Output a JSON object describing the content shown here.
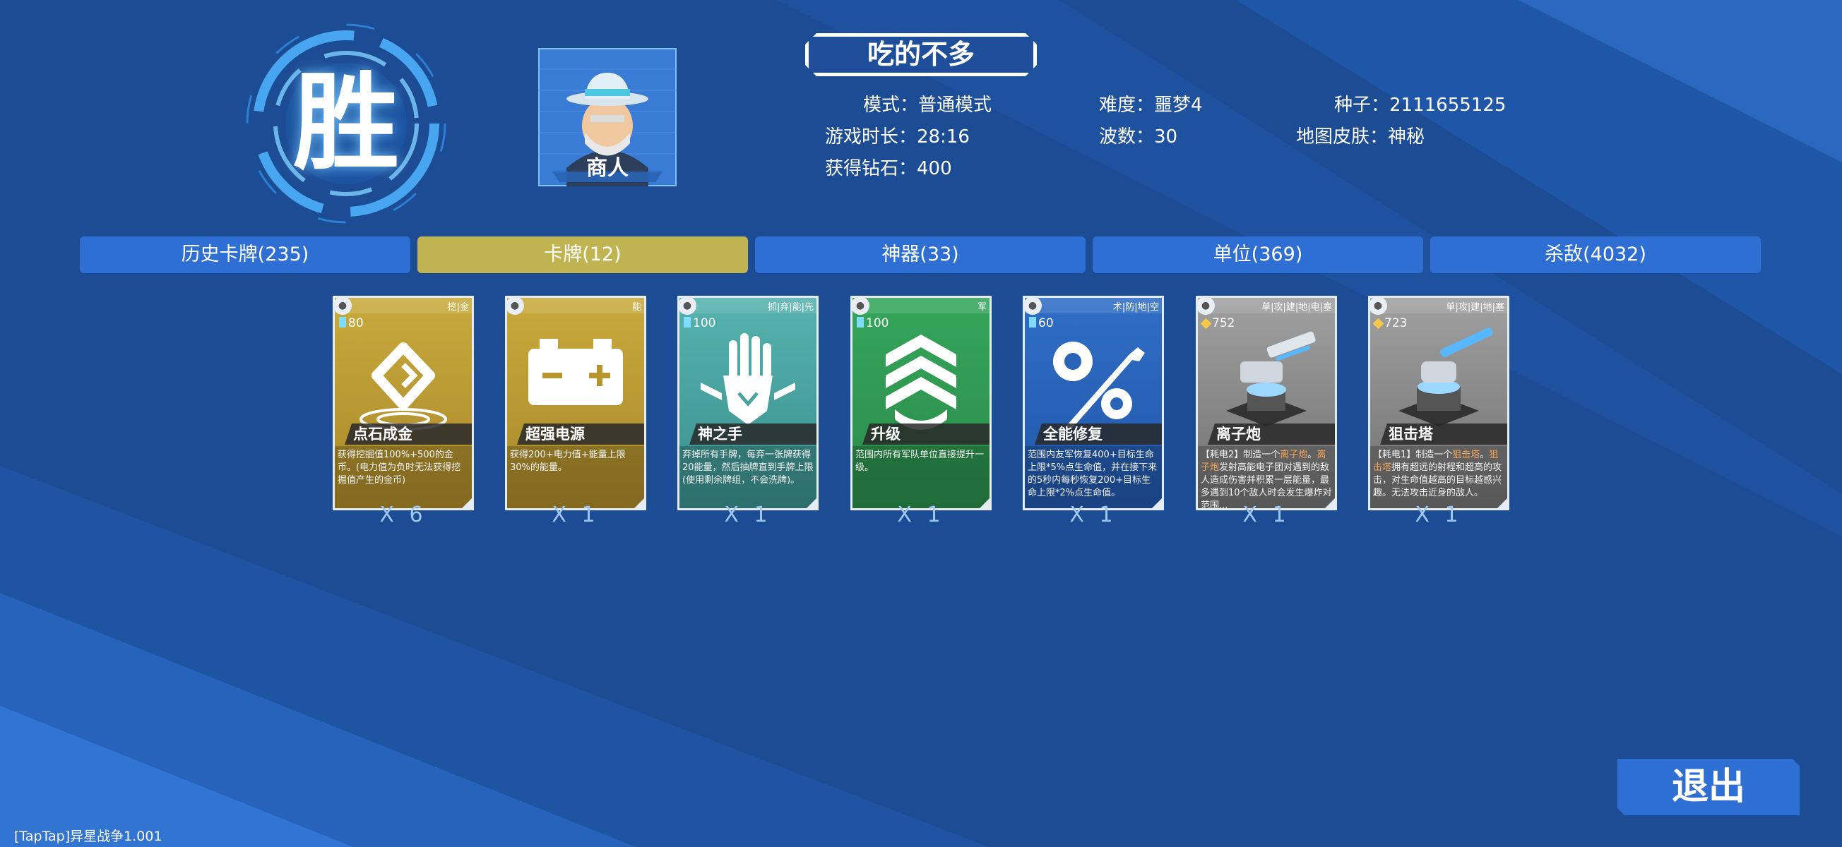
{
  "result_char": "胜",
  "character": {
    "name": "商人"
  },
  "title": "吃的不多",
  "stats": {
    "mode": {
      "label": "模式：",
      "value": "普通模式"
    },
    "difficulty": {
      "label": "难度：",
      "value": "噩梦4"
    },
    "seed": {
      "label": "种子：",
      "value": "2111655125"
    },
    "time": {
      "label": "游戏时长：",
      "value": "28:16"
    },
    "waves": {
      "label": "波数：",
      "value": "30"
    },
    "skin": {
      "label": "地图皮肤：",
      "value": "神秘"
    },
    "diamonds": {
      "label": "获得钻石：",
      "value": "400"
    }
  },
  "tabs": [
    "历史卡牌(235)",
    "卡牌(12)",
    "神器(33)",
    "单位(369)",
    "杀敌(4032)"
  ],
  "active_tab": 1,
  "cards": [
    {
      "name": "点石成金",
      "tags": "挖|金",
      "cost": "80",
      "cost_type": "energy",
      "count": "X 6",
      "desc": "获得挖掘值100%+500的金币。(电力值为负时无法获得挖掘值产生的金币)"
    },
    {
      "name": "超强电源",
      "tags": "能",
      "cost": "",
      "cost_type": "energy",
      "count": "X 1",
      "desc": "获得200+电力值+能量上限30%的能量。"
    },
    {
      "name": "神之手",
      "tags": "抓|弃|能|先",
      "cost": "100",
      "cost_type": "energy",
      "count": "X 1",
      "desc": "弃掉所有手牌，每弃一张牌获得20能量，然后抽牌直到手牌上限(使用剩余牌组，不会洗牌)。"
    },
    {
      "name": "升级",
      "tags": "军",
      "cost": "100",
      "cost_type": "energy",
      "count": "X 1",
      "desc": "范围内所有军队单位直接提升一级。"
    },
    {
      "name": "全能修复",
      "tags": "术|防|地|空",
      "cost": "60",
      "cost_type": "energy",
      "count": "X 1",
      "desc": "范围内友军恢复400+目标生命上限*5%点生命值，并在接下来的5秒内每秒恢复200+目标生命上限*2%点生命值。"
    },
    {
      "name": "离子炮",
      "tags": "单|攻|建|地|电|塞",
      "cost": "752",
      "cost_type": "gold",
      "count": "X 1",
      "desc_pre": "【耗电2】制造一个",
      "desc_hl": "离子炮",
      "desc_hl2": "离子炮",
      "desc_post": "发射高能电子团对遇到的敌人造成伤害并积累一层能量，最多遇到10个敌人时会发生爆炸对范围..."
    },
    {
      "name": "狙击塔",
      "tags": "单|攻|建|地|塞",
      "cost": "723",
      "cost_type": "gold",
      "count": "X 1",
      "desc_pre": "【耗电1】制造一个",
      "desc_hl": "狙击塔",
      "desc_hl2": "狙击塔",
      "desc_post": "拥有超远的射程和超高的攻击，对生命值越高的目标越感兴趣。无法攻击近身的敌人。"
    }
  ],
  "exit_label": "退出",
  "version": "[TapTap]异星战争1.001",
  "colors": {
    "bg": "#1c4c94",
    "tab": "#2f6fd3",
    "tab_active": "#c0b452",
    "gold_card": "#c4a43a",
    "teal_card": "#4aa3a0",
    "green_card": "#2f9a52",
    "blue_card": "#2a64b8",
    "gray_card": "#8a8a8a"
  }
}
